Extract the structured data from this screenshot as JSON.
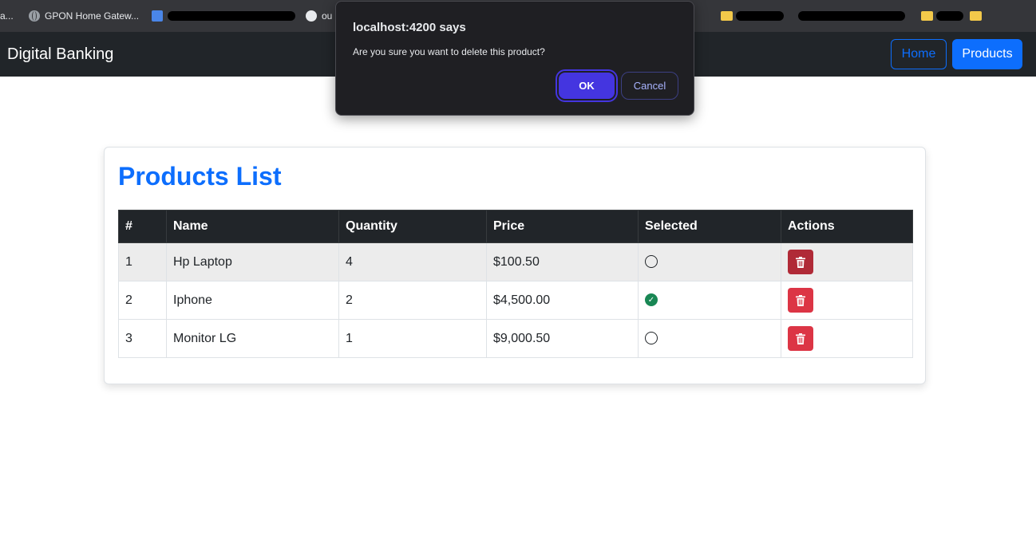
{
  "bookmarks": [
    {
      "label": "a...",
      "icon": "page-icon"
    },
    {
      "label": "GPON Home Gatew...",
      "icon": "globe-icon"
    },
    {
      "label": "",
      "icon": "person-icon"
    },
    {
      "label": "ou",
      "icon": "github-icon"
    }
  ],
  "navbar": {
    "brand": "Digital Banking",
    "home_label": "Home",
    "products_label": "Products"
  },
  "products": {
    "title": "Products List",
    "columns": [
      "#",
      "Name",
      "Quantity",
      "Price",
      "Selected",
      "Actions"
    ],
    "rows": [
      {
        "id": "1",
        "name": "Hp Laptop",
        "quantity": "4",
        "price": "$100.50",
        "selected": false
      },
      {
        "id": "2",
        "name": "Iphone",
        "quantity": "2",
        "price": "$4,500.00",
        "selected": true
      },
      {
        "id": "3",
        "name": "Monitor LG",
        "quantity": "1",
        "price": "$9,000.50",
        "selected": false
      }
    ],
    "delete_icon": "trash-icon"
  },
  "dialog": {
    "title": "localhost:4200 says",
    "message": "Are you sure you want to delete this product?",
    "ok_label": "OK",
    "cancel_label": "Cancel"
  },
  "colors": {
    "primary": "#0d6efd",
    "danger": "#dc3545",
    "success": "#198754",
    "dark": "#212529",
    "dialog_ok": "#4435e0"
  }
}
